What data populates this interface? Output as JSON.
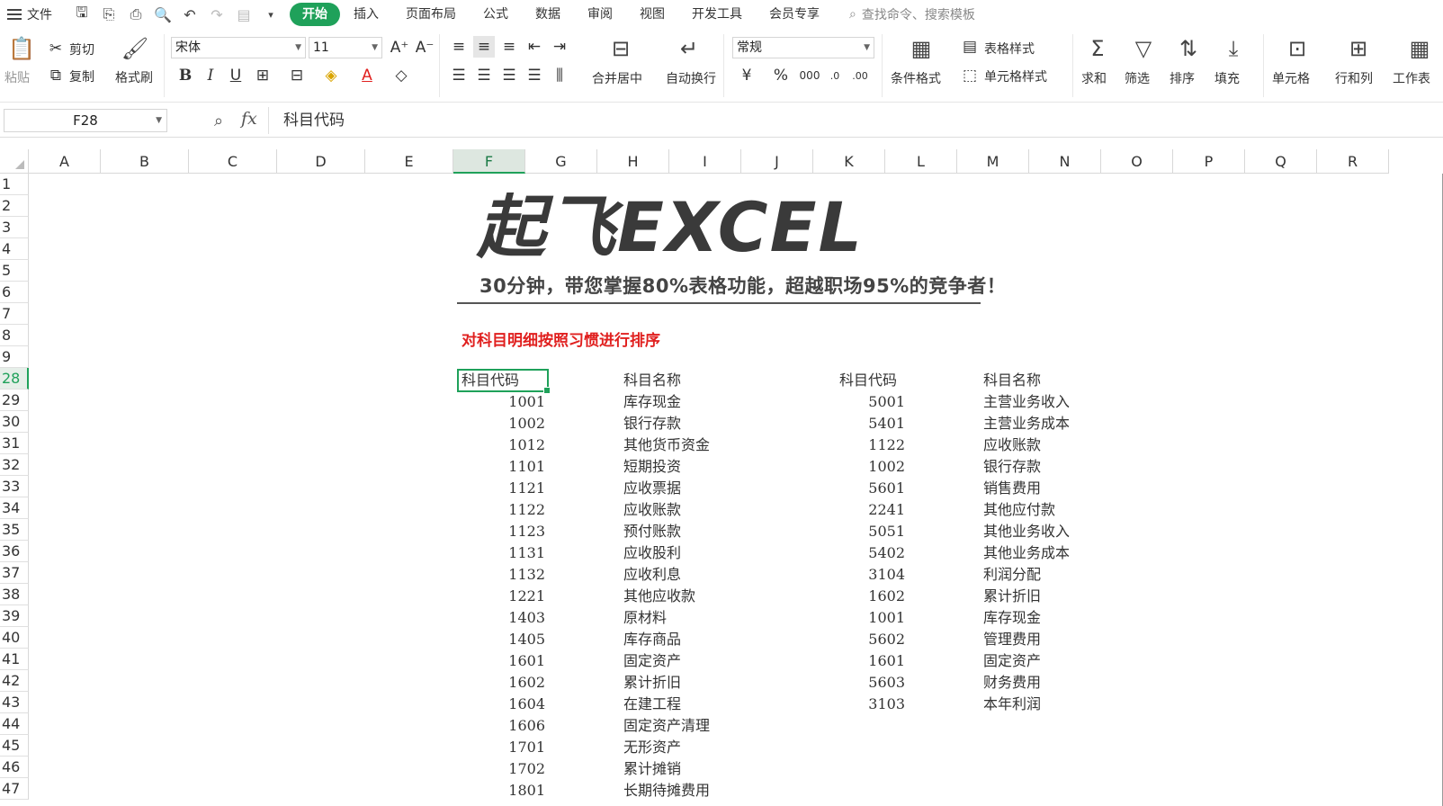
{
  "menubar": {
    "file_label": "文件",
    "tabs": [
      "开始",
      "插入",
      "页面布局",
      "公式",
      "数据",
      "审阅",
      "视图",
      "开发工具",
      "会员专享"
    ],
    "search_placeholder": "查找命令、搜索模板"
  },
  "ribbon": {
    "paste": "粘贴",
    "cut": "剪切",
    "copy": "复制",
    "format_painter": "格式刷",
    "font_name": "宋体",
    "font_size": "11",
    "merge_center": "合并居中",
    "wrap_text": "自动换行",
    "number_format": "常规",
    "conditional_format": "条件格式",
    "table_style": "表格样式",
    "cell_style": "单元格样式",
    "sum": "求和",
    "filter": "筛选",
    "sort": "排序",
    "fill": "填充",
    "cell": "单元格",
    "row_col": "行和列",
    "worksheet": "工作表"
  },
  "formula_bar": {
    "name_box": "F28",
    "fx_label": "fx",
    "content": "科目代码"
  },
  "sheet": {
    "columns": [
      "A",
      "B",
      "C",
      "D",
      "E",
      "F",
      "G",
      "H",
      "I",
      "J",
      "K",
      "L",
      "M",
      "N",
      "O",
      "P",
      "Q",
      "R"
    ],
    "selected_column": "F",
    "rows": [
      "1",
      "2",
      "3",
      "4",
      "5",
      "6",
      "7",
      "8",
      "9",
      "28",
      "29",
      "30",
      "31",
      "32",
      "33",
      "34",
      "35",
      "36",
      "37",
      "38",
      "39",
      "40",
      "41",
      "42",
      "43",
      "44",
      "45",
      "46",
      "47"
    ],
    "selected_row": "28",
    "logo_text": "起飞EXCEL",
    "subtitle": "30分钟，带您掌握80%表格功能，超越职场95%的竞争者！",
    "instruction": "对科目明细按照习惯进行排序",
    "header_code": "科目代码",
    "header_name": "科目名称",
    "left_table": [
      [
        "1001",
        "库存现金"
      ],
      [
        "1002",
        "银行存款"
      ],
      [
        "1012",
        "其他货币资金"
      ],
      [
        "1101",
        "短期投资"
      ],
      [
        "1121",
        "应收票据"
      ],
      [
        "1122",
        "应收账款"
      ],
      [
        "1123",
        "预付账款"
      ],
      [
        "1131",
        "应收股利"
      ],
      [
        "1132",
        "应收利息"
      ],
      [
        "1221",
        "其他应收款"
      ],
      [
        "1403",
        "原材料"
      ],
      [
        "1405",
        "库存商品"
      ],
      [
        "1601",
        "固定资产"
      ],
      [
        "1602",
        "累计折旧"
      ],
      [
        "1604",
        "在建工程"
      ],
      [
        "1606",
        "固定资产清理"
      ],
      [
        "1701",
        "无形资产"
      ],
      [
        "1702",
        "累计摊销"
      ],
      [
        "1801",
        "长期待摊费用"
      ]
    ],
    "right_table": [
      [
        "5001",
        "主营业务收入"
      ],
      [
        "5401",
        "主营业务成本"
      ],
      [
        "1122",
        "应收账款"
      ],
      [
        "1002",
        "银行存款"
      ],
      [
        "5601",
        "销售费用"
      ],
      [
        "2241",
        "其他应付款"
      ],
      [
        "5051",
        "其他业务收入"
      ],
      [
        "5402",
        "其他业务成本"
      ],
      [
        "3104",
        "利润分配"
      ],
      [
        "1602",
        "累计折旧"
      ],
      [
        "1001",
        "库存现金"
      ],
      [
        "5602",
        "管理费用"
      ],
      [
        "1601",
        "固定资产"
      ],
      [
        "5603",
        "财务费用"
      ],
      [
        "3103",
        "本年利润"
      ]
    ]
  }
}
